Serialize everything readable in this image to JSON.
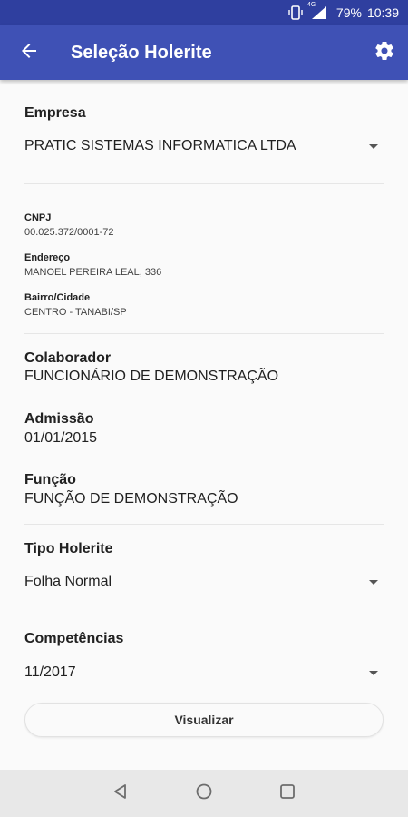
{
  "status_bar": {
    "battery_percent": "79%",
    "time": "10:39",
    "network": "4G",
    "icons": [
      "vibrate-icon",
      "signal-icon"
    ]
  },
  "app_bar": {
    "title": "Seleção Holerite",
    "back_icon": "arrow-back-icon",
    "settings_icon": "gear-icon"
  },
  "empresa": {
    "label": "Empresa",
    "selected": "PRATIC SISTEMAS INFORMATICA LTDA"
  },
  "company_info": {
    "cnpj_label": "CNPJ",
    "cnpj_value": "00.025.372/0001-72",
    "endereco_label": "Endereço",
    "endereco_value": "MANOEL PEREIRA LEAL, 336",
    "bairro_label": "Bairro/Cidade",
    "bairro_value": "CENTRO - TANABI/SP"
  },
  "colaborador": {
    "label": "Colaborador",
    "value": "FUNCIONÁRIO DE DEMONSTRAÇÃO"
  },
  "admissao": {
    "label": "Admissão",
    "value": "01/01/2015"
  },
  "funcao": {
    "label": "Função",
    "value": "FUNÇÃO DE DEMONSTRAÇÃO"
  },
  "tipo_holerite": {
    "label": "Tipo Holerite",
    "selected": "Folha Normal"
  },
  "competencias": {
    "label": "Competências",
    "selected": "11/2017"
  },
  "actions": {
    "view_label": "Visualizar"
  },
  "colors": {
    "primary": "#3f51b5",
    "primary_dark": "#2f3f9f",
    "background": "#fafafa",
    "nav_bar": "#e8e8e8"
  },
  "nav": {
    "icons": [
      "nav-back-icon",
      "nav-home-icon",
      "nav-recents-icon"
    ]
  }
}
